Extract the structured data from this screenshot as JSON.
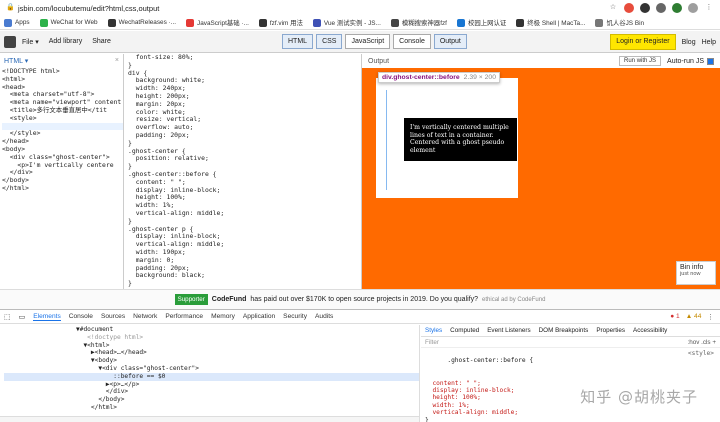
{
  "browser": {
    "url": "jsbin.com/locubutemu/edit?html,css,output",
    "bookmarks": [
      {
        "label": "Apps",
        "color": "#4a7bd0"
      },
      {
        "label": "WeChat for Web",
        "color": "#2db14a"
      },
      {
        "label": "WechatReleases ·...",
        "color": "#333333"
      },
      {
        "label": "JavaScript基础 ·...",
        "color": "#e53935"
      },
      {
        "label": "fzf.vim 用法",
        "color": "#333333"
      },
      {
        "label": "Vue 测试实例 - JS...",
        "color": "#3f51b5"
      },
      {
        "label": "模糊搜索神器fzf",
        "color": "#444444"
      },
      {
        "label": "校园上网认证",
        "color": "#1976d2"
      },
      {
        "label": "终极 Shell | MacTa...",
        "color": "#333333"
      },
      {
        "label": "饥人谷JS Bin",
        "color": "#777777"
      }
    ]
  },
  "jsbin": {
    "menu": [
      "File ▾",
      "Add library",
      "Share"
    ],
    "tabs": [
      "HTML",
      "CSS",
      "JavaScript",
      "Console",
      "Output"
    ],
    "login": "Login or Register",
    "blog": "Blog",
    "help": "Help"
  },
  "html_panel": {
    "title": "HTML ▾",
    "lines": [
      "<!DOCTYPE html>",
      "<html>",
      "<head>",
      "  <meta charset=\"utf-8\">",
      "  <meta name=\"viewport\" content",
      "  <title>多行文本垂直居中</tit",
      "  <style>",
      "",
      "  </style>",
      "</head>",
      "<body>",
      "  <div class=\"ghost-center\">",
      "    <p>I'm vertically centere",
      "  </div>",
      "</body>",
      "</html>"
    ]
  },
  "css_panel": {
    "lines": [
      "  font-size: 80%;",
      "}",
      "div {",
      "  background: white;",
      "  width: 240px;",
      "  height: 200px;",
      "  margin: 20px;",
      "  color: white;",
      "  resize: vertical;",
      "  overflow: auto;",
      "  padding: 20px;",
      "}",
      ".ghost-center {",
      "  position: relative;",
      "}",
      ".ghost-center::before {",
      "  content: \" \";",
      "  display: inline-block;",
      "  height: 100%;",
      "  width: 1%;",
      "  vertical-align: middle;",
      "}",
      ".ghost-center p {",
      "  display: inline-block;",
      "  vertical-align: middle;",
      "  width: 190px;",
      "  margin: 0;",
      "  padding: 20px;",
      "  background: black;",
      "}"
    ]
  },
  "output": {
    "title": "Output",
    "run_js": "Run with JS",
    "auto_run": "Auto-run JS",
    "tooltip_selector": "div.ghost-center::before",
    "tooltip_size": "2.39 × 200",
    "paragraph": "I'm vertically centered multiple lines of text in a container. Centered with a ghost pseudo element",
    "bin_info": "Bin info",
    "bin_sub": "just now",
    "bg_color": "#ff6a00"
  },
  "sponsor": {
    "badge": "Supporter",
    "text_bold": "CodeFund",
    "text": "has paid out over $170K to open source projects in 2019. Do you qualify?",
    "ethical": "ethical ad by CodeFund"
  },
  "devtools": {
    "tabs": [
      "Elements",
      "Console",
      "Sources",
      "Network",
      "Performance",
      "Memory",
      "Application",
      "Security",
      "Audits"
    ],
    "errors": "1",
    "warnings": "44",
    "dom_lines": [
      "▼#document",
      "   <!doctype html>",
      "  ▼<html>",
      "    ▶<head>…</head>",
      "    ▼<body>",
      "      ▼<div class=\"ghost-center\">",
      "          ::before == $0",
      "        ▶<p>…</p>",
      "        </div>",
      "      </body>",
      "    </html>"
    ],
    "style_tabs": [
      "Styles",
      "Computed",
      "Event Listeners",
      "DOM Breakpoints",
      "Properties",
      "Accessibility"
    ],
    "filter": "Filter",
    "filter_right": ":hov  .cls  +",
    "rule_selector": ".ghost-center::before {",
    "rule_source": "<style>",
    "rule_lines": [
      "  content: \" \";",
      "  display: inline-block;",
      "  height: 100%;",
      "  width: 1%;",
      "  vertical-align: middle;",
      "}"
    ],
    "watermark": "知乎 @胡桃夹子"
  }
}
